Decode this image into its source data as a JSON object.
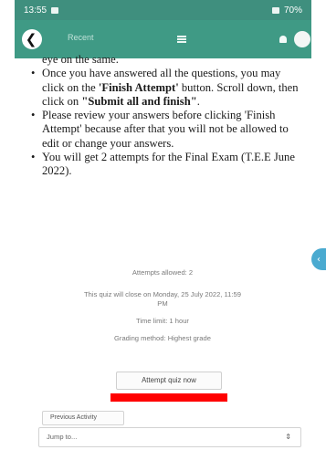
{
  "status_bar": {
    "time": "13:55",
    "right": "70%"
  },
  "app_bar": {
    "title": "Recent",
    "back_glyph": "❮"
  },
  "instructions": {
    "continued": "eye on the same.",
    "items": [
      {
        "pre": "Once you have answered all the questions, you may click on the ",
        "bold1": "'Finish Attempt'",
        "mid": " button. Scroll down, then click on ",
        "bold2": "\"Submit all and finish\"",
        "post": "."
      },
      {
        "text": "Please review your answers before clicking 'Finish Attempt' because after that you will not be allowed to edit or change your answers."
      },
      {
        "text": "You will get 2 attempts for the Final Exam (T.E.E June 2022)."
      }
    ]
  },
  "quiz_info": {
    "attempts_allowed": "Attempts allowed: 2",
    "close_line1": "This quiz will close on Monday, 25 July 2022, 11:59",
    "close_line2": "PM",
    "time_limit": "Time limit: 1 hour",
    "grading_method": "Grading method: Highest grade"
  },
  "actions": {
    "attempt_label": "Attempt quiz now",
    "previous_label": "Previous Activity",
    "jump_placeholder": "Jump to...",
    "jump_chevron": "⇕"
  },
  "side_tab_glyph": "‹",
  "colors": {
    "app_bar": "#3f9a85",
    "status_bar": "#3f8f7e",
    "highlight": "#ff0000",
    "side_tab": "#4aaad0"
  }
}
